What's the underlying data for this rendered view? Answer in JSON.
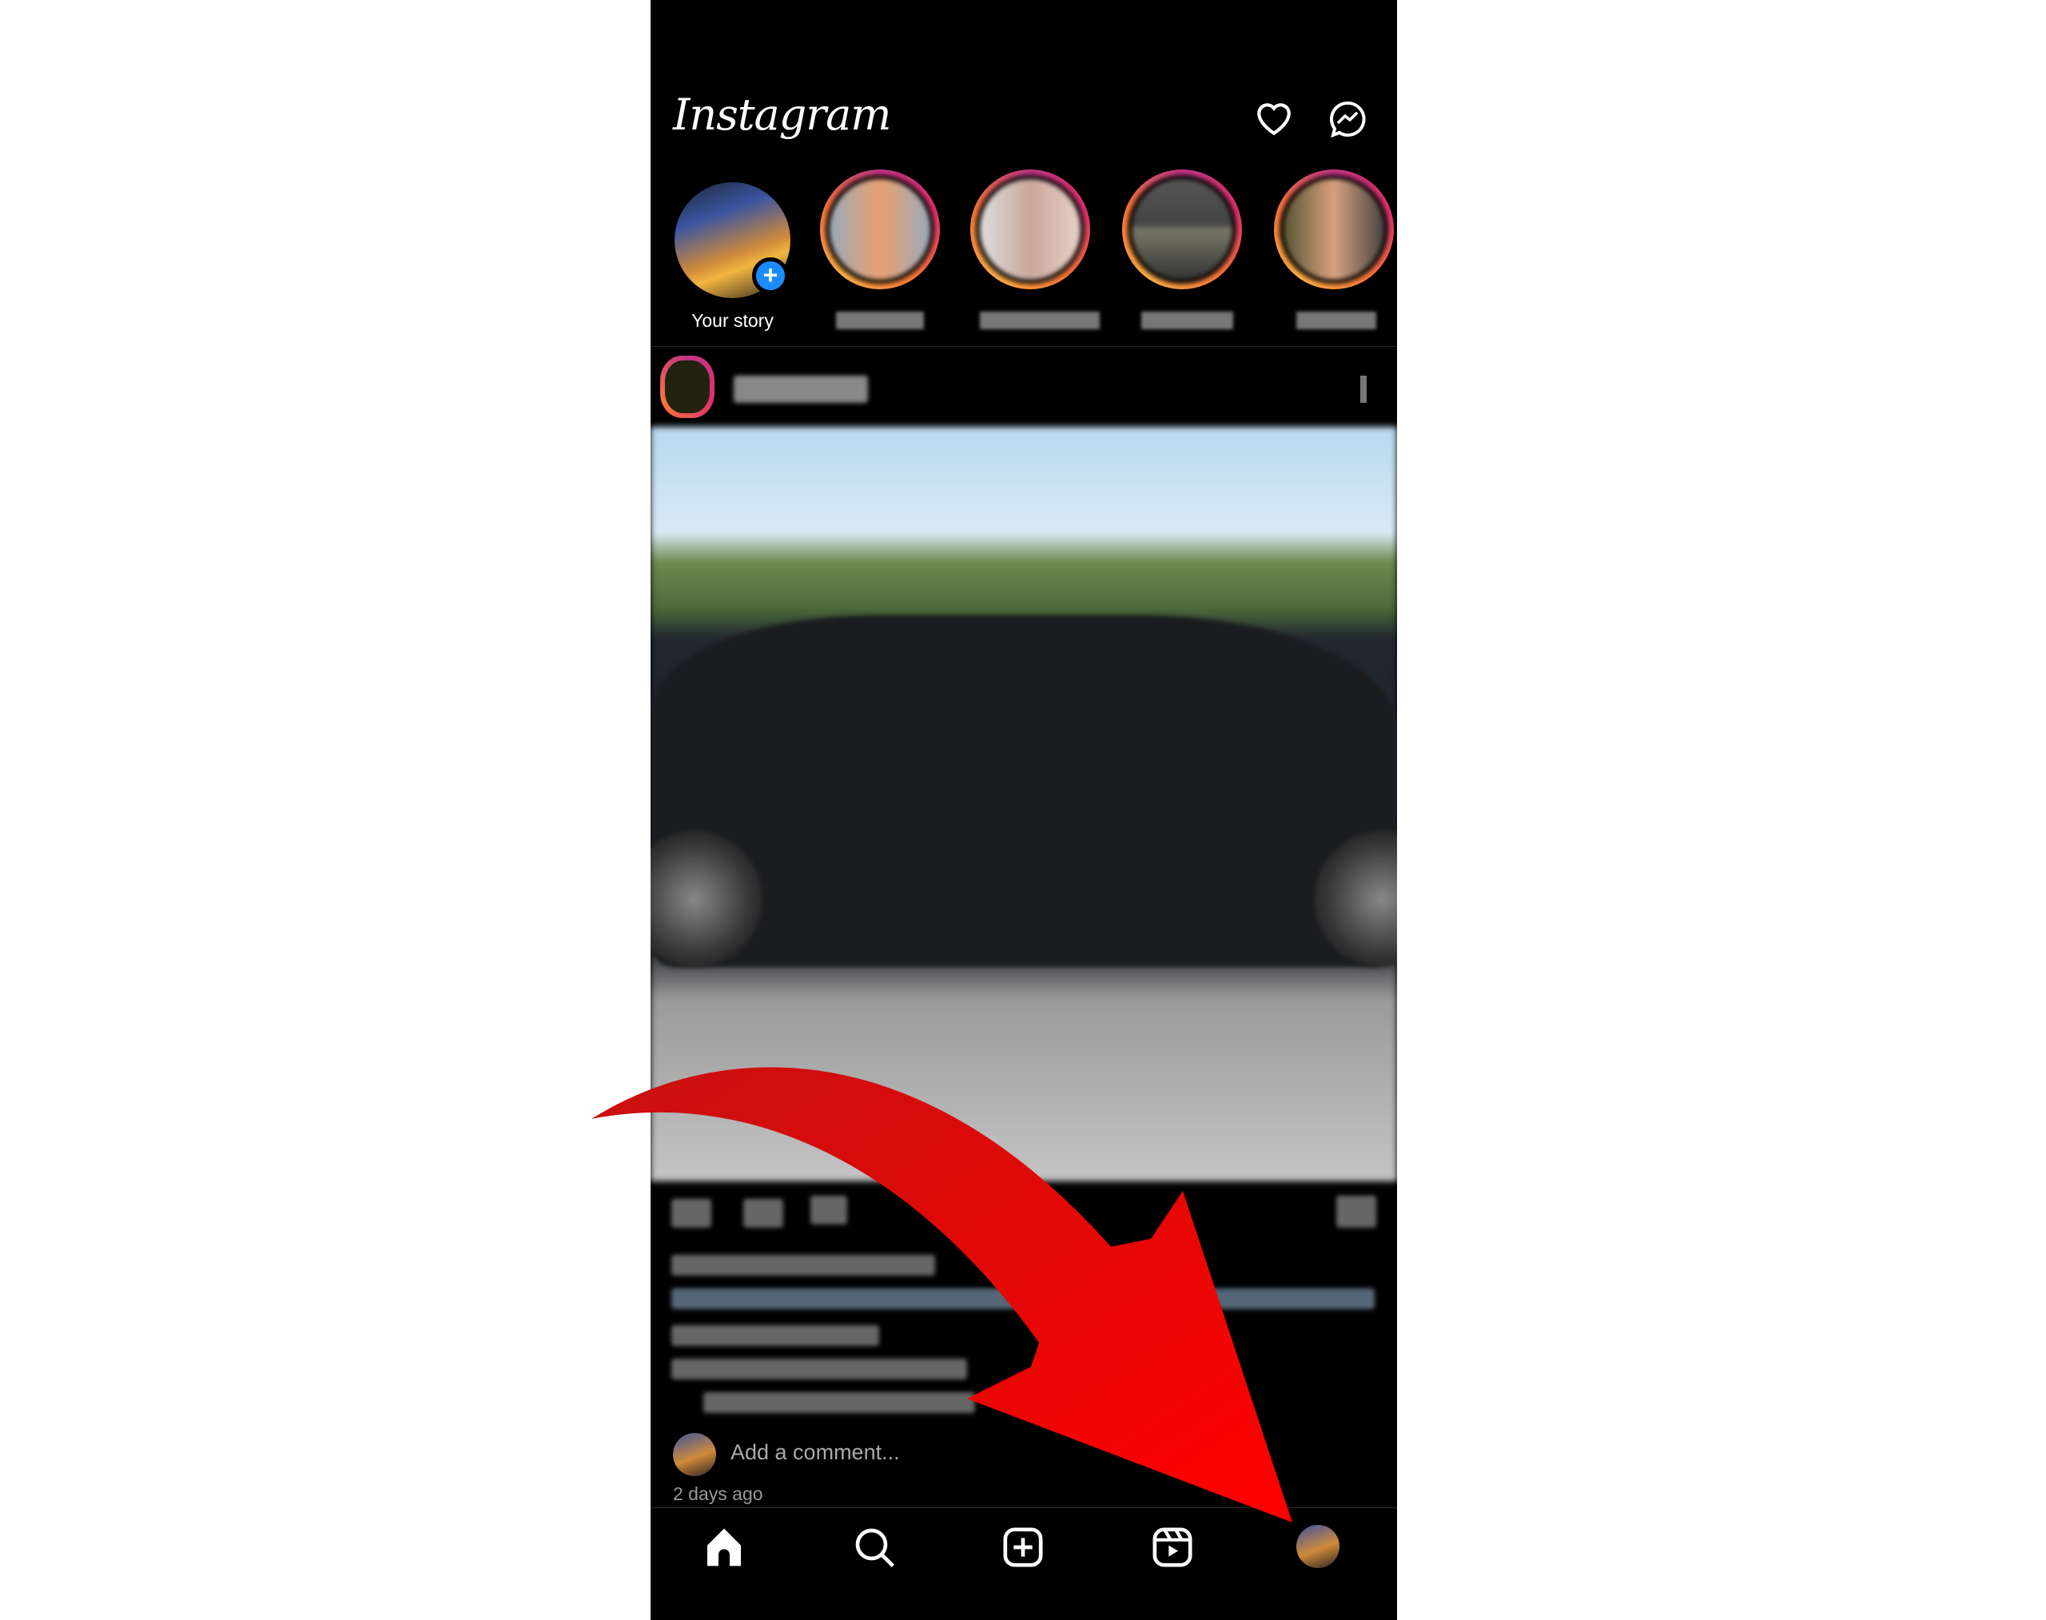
{
  "app": {
    "title": "Instagram"
  },
  "header": {
    "icons": [
      "heart-icon",
      "messenger-icon"
    ]
  },
  "stories": {
    "your_story_label": "Your story",
    "count_other": 4
  },
  "post": {
    "add_comment_placeholder": "Add a comment...",
    "timestamp": "2 days ago"
  },
  "bottom_nav": {
    "items": [
      "home-icon",
      "search-icon",
      "create-icon",
      "reels-icon",
      "profile-avatar"
    ],
    "active": "home"
  },
  "colors": {
    "add_story_badge": "#1a8cff",
    "annotation_arrow": "#ee0000"
  }
}
